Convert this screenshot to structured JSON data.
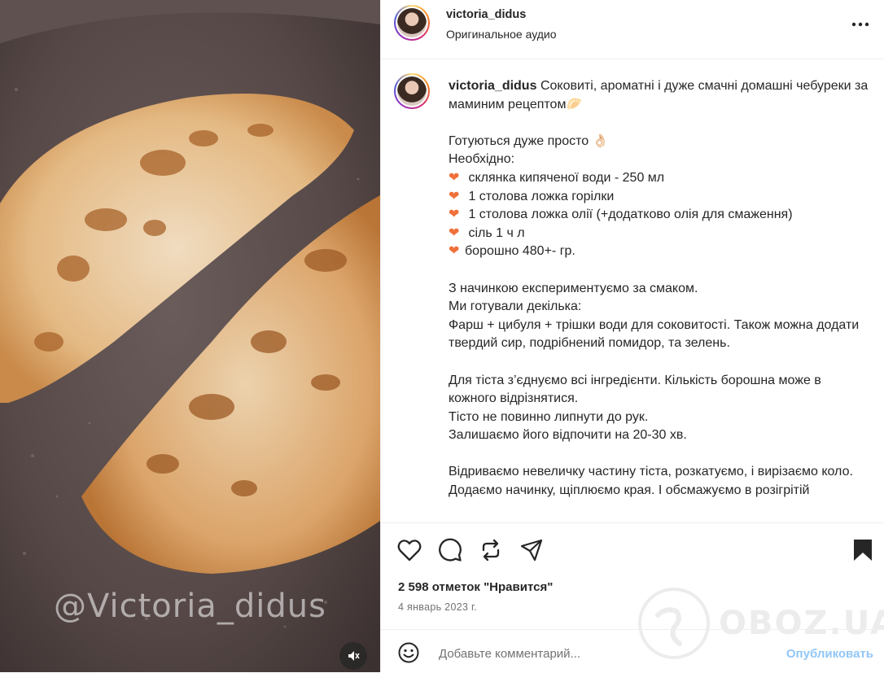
{
  "post": {
    "username": "victoria_didus",
    "audio": "Оригинальное аудио",
    "media_watermark": "@Victoria_didus",
    "caption": {
      "intro": "Соковиті, ароматні і дуже смачні домашні чебуреки за маминим рецептом",
      "intro_emoji": "🥟",
      "line_easy": "Готуються дуже просто",
      "line_easy_emoji": "👌🏻",
      "needed": "Необхідно:",
      "ingredients": [
        "склянка кипяченої води - 250 мл",
        "1 столова ложка горілки",
        "1 столова ложка олії (+додатково олія для смаження)",
        "сіль 1 ч л",
        "борошно 480+- гр."
      ],
      "ingredient_bullet": "❤",
      "filling_1": "З начинкою експериментуємо за смаком.",
      "filling_2": "Ми готували декілька:",
      "filling_3": "Фарш + цибуля + трішки води для соковитості. Також можна додати твердий сир, подрібнений помидор, та зелень.",
      "dough_1": "Для тіста з’єднуємо всі інгредієнти. Кількість борошна може в кожного відрізнятися.",
      "dough_2": "Тісто не повинно липнути до рук.",
      "dough_3": "Залишаємо його відпочити на 20-30 хв.",
      "step_1": "Відриваємо невеличку частину тіста, розкатуємо, і вирізаємо коло.",
      "step_2": "Додаємо начинку, щіплюємо края. І обсмажуємо в розігрітій"
    },
    "likes": "2 598 отметок \"Нравится\"",
    "date": "4 январь 2023 г.",
    "comment_placeholder": "Добавьте комментарий...",
    "publish_label": "Опубликовать",
    "site_watermark": "OBOZ.UA"
  },
  "icons": [
    "more-icon",
    "heart-icon",
    "comment-icon",
    "share-icon",
    "send-icon",
    "bookmark-icon",
    "emoji-icon",
    "mute-icon"
  ],
  "colors": {
    "accent_publish": "#91c6f7",
    "text": "#262626",
    "muted": "#737373",
    "heart_bullet": "#f0703a"
  }
}
